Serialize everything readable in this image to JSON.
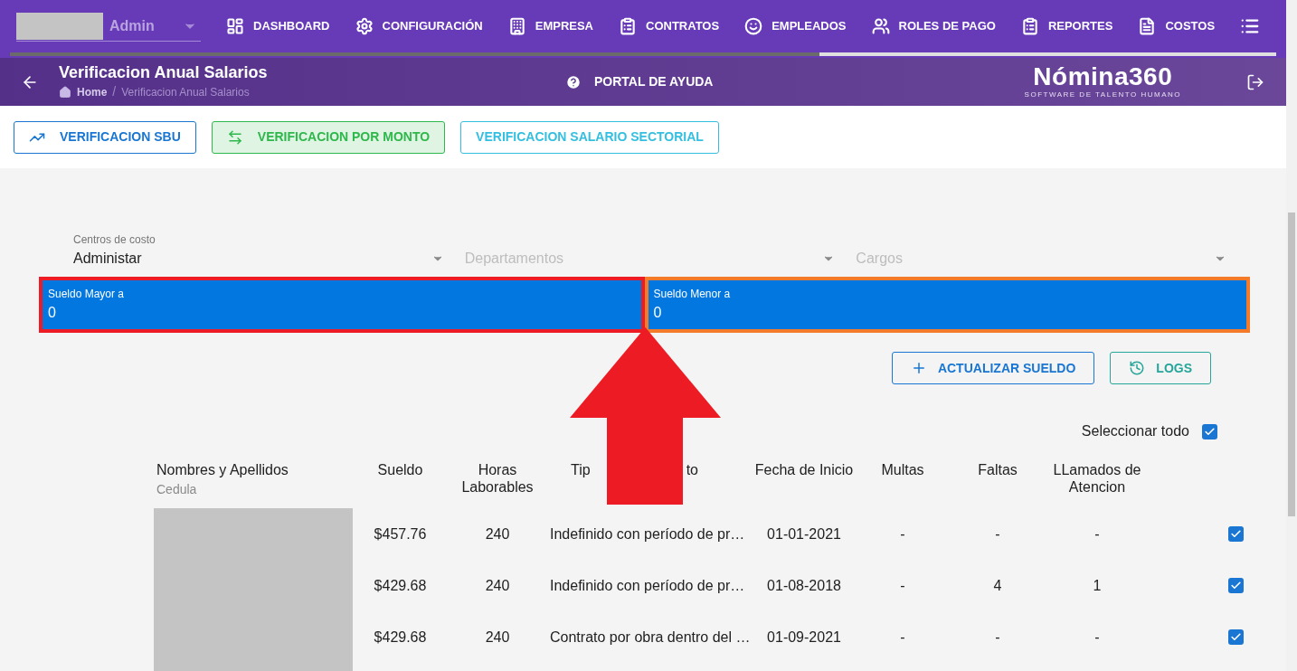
{
  "top_nav": {
    "user": {
      "name": "Admin"
    },
    "items": [
      {
        "kind": "text",
        "label": "DASHBOARD"
      },
      {
        "kind": "text",
        "label": "CONFIGURACIÓN"
      },
      {
        "kind": "text",
        "label": "EMPRESA"
      },
      {
        "kind": "text",
        "label": "CONTRATOS"
      },
      {
        "kind": "text",
        "label": "EMPLEADOS"
      },
      {
        "kind": "text",
        "label": "ROLES DE PAGO"
      },
      {
        "kind": "text",
        "label": "REPORTES"
      },
      {
        "kind": "text",
        "label": "COSTOS"
      },
      {
        "kind": "icon"
      }
    ]
  },
  "header": {
    "title": "Verificacion Anual Salarios",
    "breadcrumb": {
      "items": [
        "Home",
        "Verificacion Anual Salarios"
      ],
      "separator": "/"
    },
    "help": "PORTAL DE AYUDA",
    "logo": {
      "name": "Nómina360",
      "tagline": "SOFTWARE DE TALENTO HUMANO"
    }
  },
  "tabs": [
    {
      "label": "VERIFICACION SBU",
      "selected": false,
      "color": "#1976d2"
    },
    {
      "label": "VERIFICACION POR MONTO",
      "selected": true,
      "color": "#2eb84b"
    },
    {
      "label": "VERIFICACION SALARIO SECTORIAL",
      "selected": false,
      "color": "#33bfe0"
    }
  ],
  "filters": [
    {
      "label": "Centros de costo",
      "value": "Administar"
    },
    {
      "placeholder": "Departamentos"
    },
    {
      "placeholder": "Cargos"
    }
  ],
  "amount_fields": [
    {
      "label": "Sueldo Mayor a",
      "value": "0",
      "color": "#ed1c24"
    },
    {
      "label": "Sueldo Menor a",
      "value": "0",
      "color": "#f47b2a"
    }
  ],
  "actions": [
    {
      "label": "ACTUALIZAR SUELDO",
      "color": "#1976d2"
    },
    {
      "label": "LOGS",
      "color": "#26a69a"
    }
  ],
  "select_all": {
    "label": "Seleccionar todo",
    "checked": true
  },
  "table": {
    "columns": [
      {
        "label": "Nombres y Apellidos",
        "sublabel": "Cedula"
      },
      {
        "label": "Sueldo"
      },
      {
        "label": "Horas Laborables"
      },
      {
        "label_start": "Tip",
        "label_end": "to"
      },
      {
        "label": "Fecha de Inicio"
      },
      {
        "label": "Multas"
      },
      {
        "label": "Faltas"
      },
      {
        "label": "LLamados de Atencion"
      }
    ],
    "rows": [
      {
        "sueldo": "$457.76",
        "horas": "240",
        "tipo": "Indefinido con período de pr…",
        "fecha": "01-01-2021",
        "multas": "-",
        "faltas": "-",
        "llamados": "-",
        "checked": true
      },
      {
        "sueldo": "$429.68",
        "horas": "240",
        "tipo": "Indefinido con período de pr…",
        "fecha": "01-08-2018",
        "multas": "-",
        "faltas": "4",
        "llamados": "1",
        "checked": true
      },
      {
        "sueldo": "$429.68",
        "horas": "240",
        "tipo": "Contrato por obra dentro del …",
        "fecha": "01-09-2021",
        "multas": "-",
        "faltas": "-",
        "llamados": "-",
        "checked": true
      }
    ]
  }
}
